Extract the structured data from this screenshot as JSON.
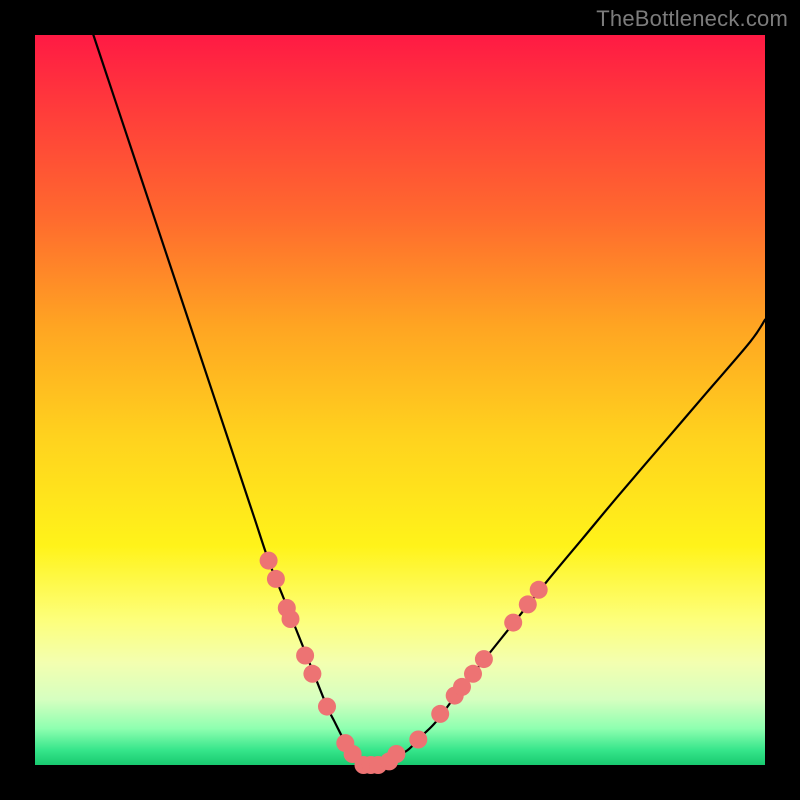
{
  "watermark": "TheBottleneck.com",
  "chart_data": {
    "type": "line",
    "title": "",
    "xlabel": "",
    "ylabel": "",
    "xlim": [
      0,
      100
    ],
    "ylim": [
      0,
      100
    ],
    "grid": false,
    "series": [
      {
        "name": "bottleneck-curve",
        "x": [
          8,
          10,
          13,
          16,
          19,
          22,
          25,
          28,
          30,
          32,
          34,
          36,
          38,
          40,
          41,
          42,
          43,
          44,
          45,
          46,
          47,
          49,
          51,
          53,
          55,
          58,
          62,
          66,
          70,
          75,
          80,
          86,
          92,
          98,
          100
        ],
        "values": [
          100,
          94,
          85,
          76,
          67,
          58,
          49,
          40,
          34,
          28,
          23,
          18,
          13,
          8,
          6,
          4,
          2,
          1,
          0,
          0,
          0,
          1,
          2,
          4,
          6,
          10,
          15,
          20,
          25,
          31,
          37,
          44,
          51,
          58,
          61
        ]
      }
    ],
    "markers": {
      "name": "highlight-dots",
      "color": "#ed7373",
      "points": [
        {
          "x": 32.0,
          "y": 28.0
        },
        {
          "x": 33.0,
          "y": 25.5
        },
        {
          "x": 34.5,
          "y": 21.5
        },
        {
          "x": 35.0,
          "y": 20.0
        },
        {
          "x": 37.0,
          "y": 15.0
        },
        {
          "x": 38.0,
          "y": 12.5
        },
        {
          "x": 40.0,
          "y": 8.0
        },
        {
          "x": 42.5,
          "y": 3.0
        },
        {
          "x": 43.5,
          "y": 1.5
        },
        {
          "x": 45.0,
          "y": 0.0
        },
        {
          "x": 46.0,
          "y": 0.0
        },
        {
          "x": 47.0,
          "y": 0.0
        },
        {
          "x": 48.5,
          "y": 0.5
        },
        {
          "x": 49.5,
          "y": 1.5
        },
        {
          "x": 52.5,
          "y": 3.5
        },
        {
          "x": 55.5,
          "y": 7.0
        },
        {
          "x": 57.5,
          "y": 9.5
        },
        {
          "x": 58.5,
          "y": 10.7
        },
        {
          "x": 60.0,
          "y": 12.5
        },
        {
          "x": 61.5,
          "y": 14.5
        },
        {
          "x": 65.5,
          "y": 19.5
        },
        {
          "x": 67.5,
          "y": 22.0
        },
        {
          "x": 69.0,
          "y": 24.0
        }
      ]
    }
  }
}
